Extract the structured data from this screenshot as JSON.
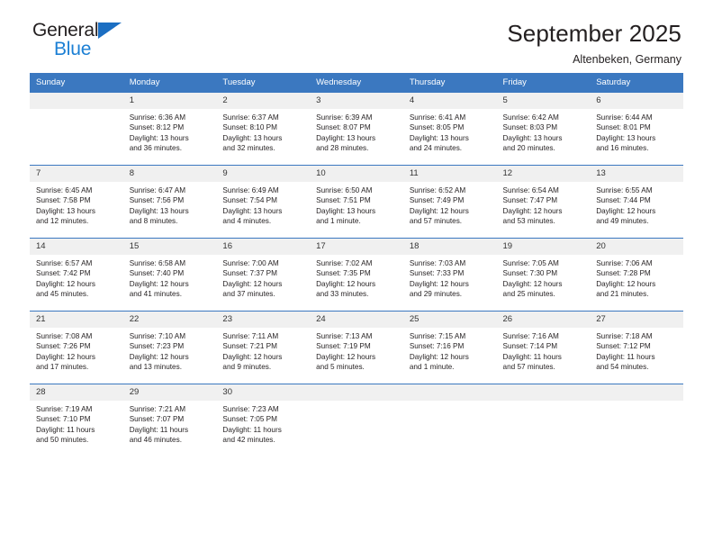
{
  "brand": {
    "name_part1": "General",
    "name_part2": "Blue",
    "triangle_color": "#1b6ec2",
    "blue_color": "#1b7fd4"
  },
  "header": {
    "title": "September 2025",
    "subtitle": "Altenbeken, Germany"
  },
  "theme": {
    "header_row_bg": "#3b78c0",
    "daynum_bg": "#f0f0f0",
    "page_bg": "#ffffff",
    "text_color": "#231f20"
  },
  "labels": {
    "sunrise_prefix": "Sunrise:",
    "sunset_prefix": "Sunset:",
    "daylight_prefix": "Daylight:"
  },
  "weekdays": [
    "Sunday",
    "Monday",
    "Tuesday",
    "Wednesday",
    "Thursday",
    "Friday",
    "Saturday"
  ],
  "weeks": [
    [
      {
        "day": "",
        "sunrise": "",
        "sunset": "",
        "daylight": "",
        "daylight2": "",
        "blank": true
      },
      {
        "day": "1",
        "sunrise": "Sunrise: 6:36 AM",
        "sunset": "Sunset: 8:12 PM",
        "daylight": "Daylight: 13 hours",
        "daylight2": "and 36 minutes."
      },
      {
        "day": "2",
        "sunrise": "Sunrise: 6:37 AM",
        "sunset": "Sunset: 8:10 PM",
        "daylight": "Daylight: 13 hours",
        "daylight2": "and 32 minutes."
      },
      {
        "day": "3",
        "sunrise": "Sunrise: 6:39 AM",
        "sunset": "Sunset: 8:07 PM",
        "daylight": "Daylight: 13 hours",
        "daylight2": "and 28 minutes."
      },
      {
        "day": "4",
        "sunrise": "Sunrise: 6:41 AM",
        "sunset": "Sunset: 8:05 PM",
        "daylight": "Daylight: 13 hours",
        "daylight2": "and 24 minutes."
      },
      {
        "day": "5",
        "sunrise": "Sunrise: 6:42 AM",
        "sunset": "Sunset: 8:03 PM",
        "daylight": "Daylight: 13 hours",
        "daylight2": "and 20 minutes."
      },
      {
        "day": "6",
        "sunrise": "Sunrise: 6:44 AM",
        "sunset": "Sunset: 8:01 PM",
        "daylight": "Daylight: 13 hours",
        "daylight2": "and 16 minutes."
      }
    ],
    [
      {
        "day": "7",
        "sunrise": "Sunrise: 6:45 AM",
        "sunset": "Sunset: 7:58 PM",
        "daylight": "Daylight: 13 hours",
        "daylight2": "and 12 minutes."
      },
      {
        "day": "8",
        "sunrise": "Sunrise: 6:47 AM",
        "sunset": "Sunset: 7:56 PM",
        "daylight": "Daylight: 13 hours",
        "daylight2": "and 8 minutes."
      },
      {
        "day": "9",
        "sunrise": "Sunrise: 6:49 AM",
        "sunset": "Sunset: 7:54 PM",
        "daylight": "Daylight: 13 hours",
        "daylight2": "and 4 minutes."
      },
      {
        "day": "10",
        "sunrise": "Sunrise: 6:50 AM",
        "sunset": "Sunset: 7:51 PM",
        "daylight": "Daylight: 13 hours",
        "daylight2": "and 1 minute."
      },
      {
        "day": "11",
        "sunrise": "Sunrise: 6:52 AM",
        "sunset": "Sunset: 7:49 PM",
        "daylight": "Daylight: 12 hours",
        "daylight2": "and 57 minutes."
      },
      {
        "day": "12",
        "sunrise": "Sunrise: 6:54 AM",
        "sunset": "Sunset: 7:47 PM",
        "daylight": "Daylight: 12 hours",
        "daylight2": "and 53 minutes."
      },
      {
        "day": "13",
        "sunrise": "Sunrise: 6:55 AM",
        "sunset": "Sunset: 7:44 PM",
        "daylight": "Daylight: 12 hours",
        "daylight2": "and 49 minutes."
      }
    ],
    [
      {
        "day": "14",
        "sunrise": "Sunrise: 6:57 AM",
        "sunset": "Sunset: 7:42 PM",
        "daylight": "Daylight: 12 hours",
        "daylight2": "and 45 minutes."
      },
      {
        "day": "15",
        "sunrise": "Sunrise: 6:58 AM",
        "sunset": "Sunset: 7:40 PM",
        "daylight": "Daylight: 12 hours",
        "daylight2": "and 41 minutes."
      },
      {
        "day": "16",
        "sunrise": "Sunrise: 7:00 AM",
        "sunset": "Sunset: 7:37 PM",
        "daylight": "Daylight: 12 hours",
        "daylight2": "and 37 minutes."
      },
      {
        "day": "17",
        "sunrise": "Sunrise: 7:02 AM",
        "sunset": "Sunset: 7:35 PM",
        "daylight": "Daylight: 12 hours",
        "daylight2": "and 33 minutes."
      },
      {
        "day": "18",
        "sunrise": "Sunrise: 7:03 AM",
        "sunset": "Sunset: 7:33 PM",
        "daylight": "Daylight: 12 hours",
        "daylight2": "and 29 minutes."
      },
      {
        "day": "19",
        "sunrise": "Sunrise: 7:05 AM",
        "sunset": "Sunset: 7:30 PM",
        "daylight": "Daylight: 12 hours",
        "daylight2": "and 25 minutes."
      },
      {
        "day": "20",
        "sunrise": "Sunrise: 7:06 AM",
        "sunset": "Sunset: 7:28 PM",
        "daylight": "Daylight: 12 hours",
        "daylight2": "and 21 minutes."
      }
    ],
    [
      {
        "day": "21",
        "sunrise": "Sunrise: 7:08 AM",
        "sunset": "Sunset: 7:26 PM",
        "daylight": "Daylight: 12 hours",
        "daylight2": "and 17 minutes."
      },
      {
        "day": "22",
        "sunrise": "Sunrise: 7:10 AM",
        "sunset": "Sunset: 7:23 PM",
        "daylight": "Daylight: 12 hours",
        "daylight2": "and 13 minutes."
      },
      {
        "day": "23",
        "sunrise": "Sunrise: 7:11 AM",
        "sunset": "Sunset: 7:21 PM",
        "daylight": "Daylight: 12 hours",
        "daylight2": "and 9 minutes."
      },
      {
        "day": "24",
        "sunrise": "Sunrise: 7:13 AM",
        "sunset": "Sunset: 7:19 PM",
        "daylight": "Daylight: 12 hours",
        "daylight2": "and 5 minutes."
      },
      {
        "day": "25",
        "sunrise": "Sunrise: 7:15 AM",
        "sunset": "Sunset: 7:16 PM",
        "daylight": "Daylight: 12 hours",
        "daylight2": "and 1 minute."
      },
      {
        "day": "26",
        "sunrise": "Sunrise: 7:16 AM",
        "sunset": "Sunset: 7:14 PM",
        "daylight": "Daylight: 11 hours",
        "daylight2": "and 57 minutes."
      },
      {
        "day": "27",
        "sunrise": "Sunrise: 7:18 AM",
        "sunset": "Sunset: 7:12 PM",
        "daylight": "Daylight: 11 hours",
        "daylight2": "and 54 minutes."
      }
    ],
    [
      {
        "day": "28",
        "sunrise": "Sunrise: 7:19 AM",
        "sunset": "Sunset: 7:10 PM",
        "daylight": "Daylight: 11 hours",
        "daylight2": "and 50 minutes."
      },
      {
        "day": "29",
        "sunrise": "Sunrise: 7:21 AM",
        "sunset": "Sunset: 7:07 PM",
        "daylight": "Daylight: 11 hours",
        "daylight2": "and 46 minutes."
      },
      {
        "day": "30",
        "sunrise": "Sunrise: 7:23 AM",
        "sunset": "Sunset: 7:05 PM",
        "daylight": "Daylight: 11 hours",
        "daylight2": "and 42 minutes."
      },
      {
        "day": "",
        "sunrise": "",
        "sunset": "",
        "daylight": "",
        "daylight2": "",
        "blank": true
      },
      {
        "day": "",
        "sunrise": "",
        "sunset": "",
        "daylight": "",
        "daylight2": "",
        "blank": true
      },
      {
        "day": "",
        "sunrise": "",
        "sunset": "",
        "daylight": "",
        "daylight2": "",
        "blank": true
      },
      {
        "day": "",
        "sunrise": "",
        "sunset": "",
        "daylight": "",
        "daylight2": "",
        "blank": true
      }
    ]
  ]
}
